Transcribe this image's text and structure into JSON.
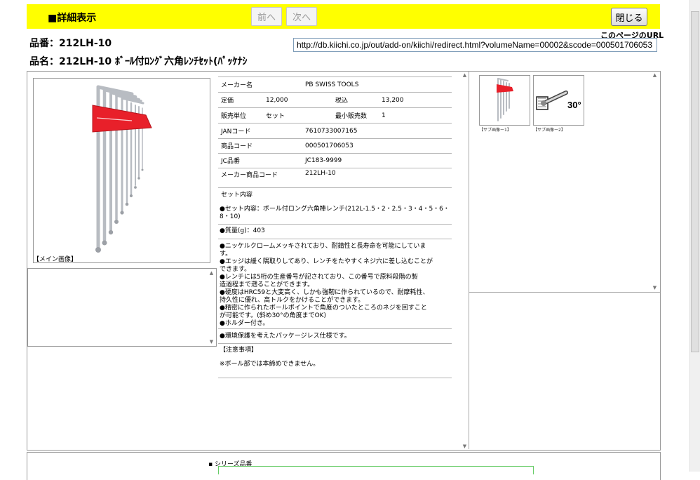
{
  "header": {
    "title": "■詳細表示",
    "prev_label": "前へ",
    "next_label": "次へ",
    "close_label": "閉じる"
  },
  "product": {
    "number_line": "品番：212LH-10",
    "name_line": "品名：212LH-10 ﾎﾞｰﾙ付ﾛﾝｸﾞ六角ﾚﾝﾁｾｯﾄ(ﾊﾟｯｹﾅｼ"
  },
  "page_url": {
    "label": "このページのURL",
    "value": "http://db.kiichi.co.jp/out/add-on/kiichi/redirect.html?volumeName=00002&scode=000501706053"
  },
  "main_image": {
    "label": "【メイン画像】"
  },
  "specs": {
    "maker_label": "メーカー名",
    "maker_value": "PB SWISS TOOLS",
    "list_price_label": "定価",
    "list_price_value": "12,000",
    "tax_in_label": "税込",
    "tax_in_value": "13,200",
    "sales_unit_label": "販売単位",
    "sales_unit_value": "セット",
    "min_qty_label": "最小販売数",
    "min_qty_value": "1",
    "jan_label": "JANコード",
    "jan_value": "7610733007165",
    "product_code_label": "商品コード",
    "product_code_value": "000501706053",
    "jc_label": "JC品番",
    "jc_value": "JC183-9999",
    "maker_code_label": "メーカー商品コード",
    "maker_code_value": "212LH-10"
  },
  "set_contents": {
    "heading": "セット内容",
    "line1": "●セット内容：ボール付ロング六角棒レンチ(212L-1.5・2・2.5・3・4・5・6・",
    "line2": "8・10)"
  },
  "weight": "●質量(g)：403",
  "features": [
    "●ニッケルクロームメッキされており、耐錆性と長寿命を可能にしていま",
    "す。",
    "●エッジは緩く隅取りしてあり、レンチをたやすくネジ穴に差し込むことが",
    "できます。",
    "●レンチには5桁の生産番号が記されており、この番号で原料段階の製",
    "造過程まで遡ることができます。",
    "●硬度はHRC59と大変高く、しかも強靭に作られているので、耐摩耗性、",
    "持久性に優れ、高トルクをかけることができます。",
    "●精密に作られたボールポイントで角度のついたところのネジを回すこと",
    "が可能です。(斜め30°の角度までOK)",
    "●ホルダー付き。"
  ],
  "packaging": "●環境保護を考えたパッケージレス仕様です。",
  "notes": {
    "heading": "【注意事項】",
    "text": "※ボール部では本締めできません。"
  },
  "sub_images": [
    {
      "label": "【サブ画像ー1】"
    },
    {
      "label": "【サブ画像ー2】",
      "angle_text": "30°"
    }
  ],
  "series": {
    "label": "シリーズ品番"
  }
}
